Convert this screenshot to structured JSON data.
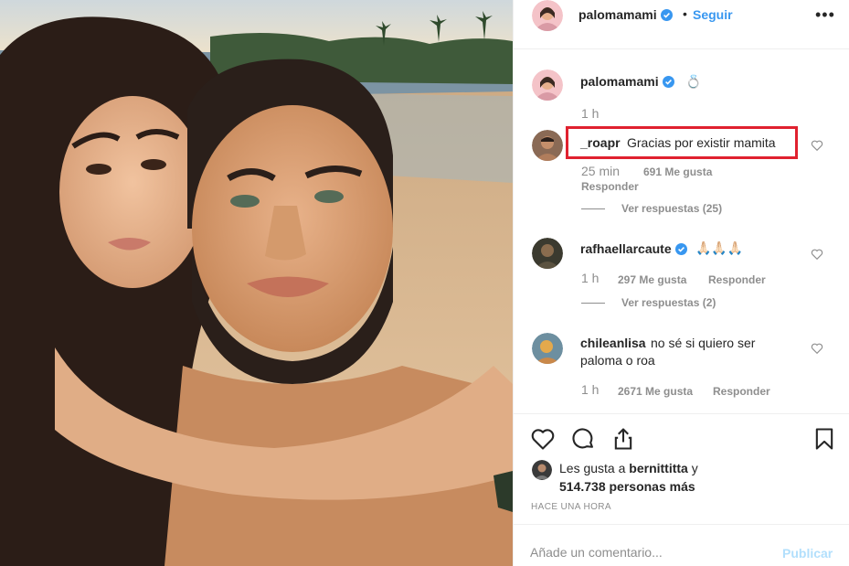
{
  "post": {
    "author": "palomamami",
    "follow_label": "Seguir",
    "separator": "•",
    "more_label": "•••"
  },
  "caption": {
    "user": "palomamami",
    "emoji": "💍",
    "time": "1 h"
  },
  "comments": [
    {
      "user": "_roapr",
      "text": "Gracias por existir mamita",
      "time": "25 min",
      "likes": "691 Me gusta",
      "reply_label": "Responder",
      "view_replies": "Ver respuestas (25)"
    },
    {
      "user": "rafhaellarcaute",
      "text": "🙏🏻🙏🏻🙏🏻",
      "time": "1 h",
      "likes": "297 Me gusta",
      "reply_label": "Responder",
      "view_replies": "Ver respuestas (2)"
    },
    {
      "user": "chileanlisa",
      "text": "no sé si quiero ser paloma o roa",
      "time": "1 h",
      "likes": "2671 Me gusta",
      "reply_label": "Responder"
    }
  ],
  "likes": {
    "prefix": "Les gusta a",
    "user": "bernittitta",
    "conj": "y",
    "count": "514.738",
    "suffix": "personas más"
  },
  "posted_ago": "HACE UNA HORA",
  "comment_box": {
    "placeholder": "Añade un comentario...",
    "publish_label": "Publicar"
  },
  "icons": {
    "like": "heart-icon",
    "comment": "comment-bubble-icon",
    "share": "share-icon",
    "save": "bookmark-icon",
    "verified": "verified-badge-icon"
  },
  "colors": {
    "link_blue": "#3897f0",
    "highlight_red": "#e0212f",
    "muted_text": "#8e8e8e"
  }
}
